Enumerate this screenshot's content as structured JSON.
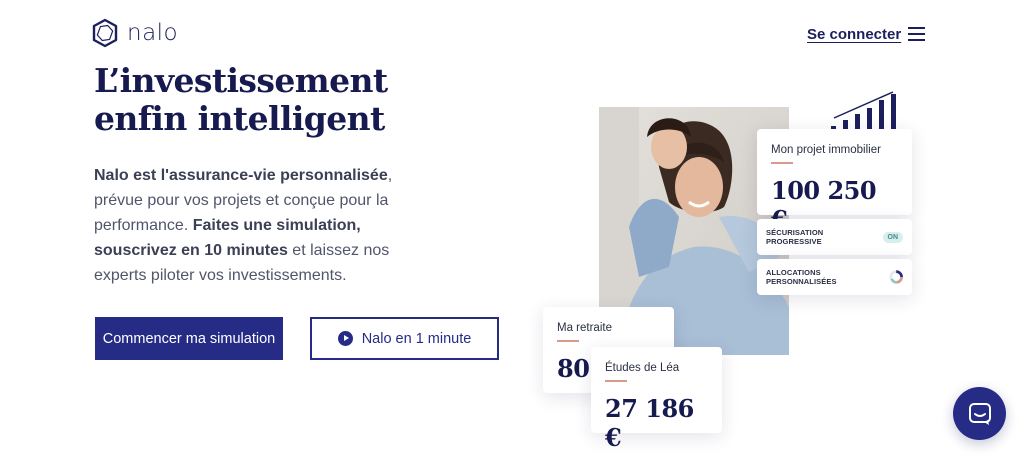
{
  "header": {
    "logo_text": "nalo",
    "login_label": "Se connecter",
    "menu_icon": "hamburger-menu-icon"
  },
  "hero": {
    "title_line1": "L’investissement",
    "title_line2": "enfin intelligent",
    "text_bold1": "Nalo est l'assurance-vie personnalisée",
    "text_part1": ", prévue pour vos projets et conçue pour la performance. ",
    "text_bold2": "Faites une simulation, souscrivez en 10 minutes",
    "text_part2": " et laissez nos experts piloter vos investissements."
  },
  "buttons": {
    "primary_label": "Commencer ma simulation",
    "secondary_label": "Nalo en 1 minute",
    "secondary_icon": "play-icon"
  },
  "cards": {
    "immo_label": "Mon projet immobilier",
    "immo_value": "100 250 €",
    "secu_label": "SÉCURISATION PROGRESSIVE",
    "secu_toggle": "ON",
    "alloc_label": "ALLOCATIONS PERSONNALISÉES",
    "retraite_label": "Ma retraite",
    "retraite_value": "80",
    "etudes_label": "Études de Léa",
    "etudes_value": "27 186 €"
  },
  "colors": {
    "brand": "#262c85",
    "title": "#161a4f",
    "accent": "#d99a8c"
  },
  "chat": {
    "icon": "chat-icon"
  }
}
